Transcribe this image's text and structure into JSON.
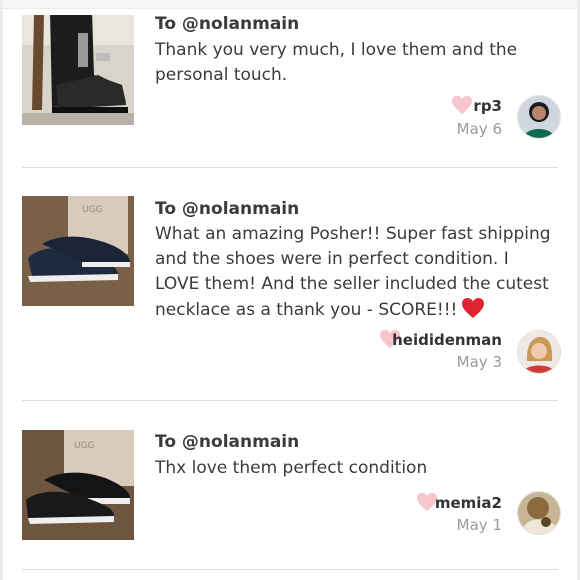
{
  "reviews": [
    {
      "to": "To @nolanmain",
      "message": "Thank you very much, I love them and the personal touch.",
      "username": "rp3",
      "date": "May 6",
      "photo_icon": "boot-photo-icon",
      "avatar_icon": "avatar-photo-icon"
    },
    {
      "to": "To @nolanmain",
      "message": "What an amazing Posher!! Super fast shipping and the shoes were in perfect condition. I LOVE them! And the seller included the cutest necklace as a thank you - SCORE!!!",
      "username": "heididenman",
      "date": "May 3",
      "photo_icon": "slip-on-shoe-photo-icon",
      "avatar_icon": "avatar-photo-icon"
    },
    {
      "to": "To @nolanmain",
      "message": "Thx love them perfect condition",
      "username": "memia2",
      "date": "May 1",
      "photo_icon": "slip-on-shoe-photo-icon",
      "avatar_icon": "avatar-photo-icon"
    }
  ],
  "colors": {
    "like_heart": "#f7c5cd",
    "emoji_heart": "#e0242f",
    "divider": "#dedede",
    "date_text": "#9a9a9a"
  }
}
